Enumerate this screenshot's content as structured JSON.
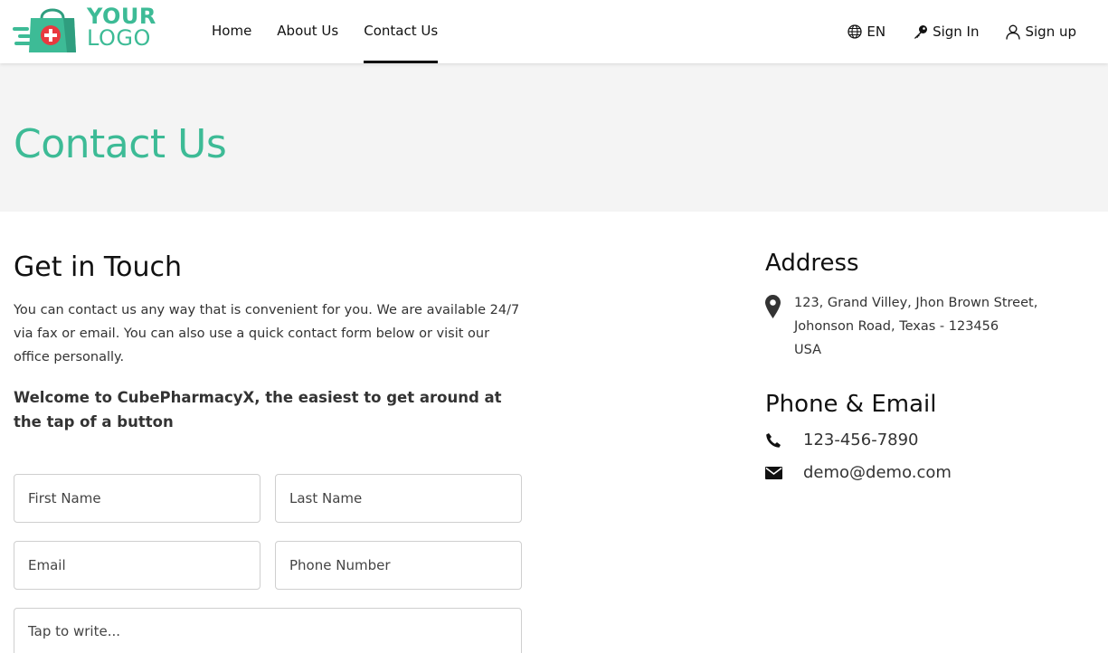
{
  "brand": {
    "logo_line1": "YOUR",
    "logo_line2": "LOGO",
    "accent": "#3dbb96",
    "logo_red": "#e8393f"
  },
  "nav": {
    "items": [
      {
        "label": "Home",
        "active": false
      },
      {
        "label": "About Us",
        "active": false
      },
      {
        "label": "Contact Us",
        "active": true
      }
    ],
    "language": "EN",
    "sign_in": "Sign In",
    "sign_up": "Sign up"
  },
  "banner": {
    "title": "Contact Us"
  },
  "get_in_touch": {
    "title": "Get in Touch",
    "intro": "You can contact us any way that is convenient for you. We are available 24/7 via fax or email. You can also use a quick contact form below or visit our office personally.",
    "welcome": "Welcome to CubePharmacyX, the easiest to get around at the tap of a button"
  },
  "form": {
    "first_name_placeholder": "First Name",
    "last_name_placeholder": "Last Name",
    "email_placeholder": "Email",
    "phone_placeholder": "Phone Number",
    "message_placeholder": "Tap to write..."
  },
  "address": {
    "title": "Address",
    "line1": "123, Grand Villey, Jhon Brown Street,",
    "line2": "Johonson Road, Texas - 123456",
    "line3": "USA"
  },
  "phone_email": {
    "title": "Phone & Email",
    "phone": "123-456-7890",
    "email": "demo@demo.com"
  }
}
